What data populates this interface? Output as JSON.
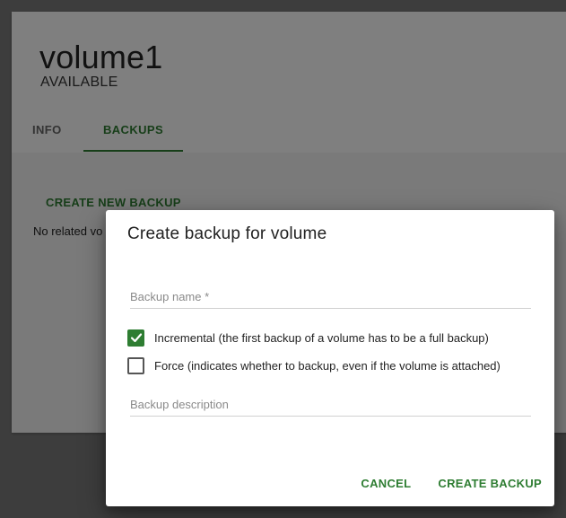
{
  "card": {
    "title": "volume1",
    "status": "AVAILABLE",
    "tabs": [
      {
        "label": "INFO"
      },
      {
        "label": "BACKUPS"
      }
    ],
    "create_new_label": "CREATE NEW BACKUP",
    "no_related_text": "No related vo"
  },
  "dialog": {
    "title": "Create backup for volume",
    "backup_name_placeholder": "Backup name *",
    "backup_description_placeholder": "Backup description",
    "incremental_label": "Incremental (the first backup of a volume has to be a full backup)",
    "incremental_checked": true,
    "force_label": "Force (indicates whether to backup, even if the volume is attached)",
    "force_checked": false,
    "cancel_label": "CANCEL",
    "create_label": "CREATE BACKUP"
  },
  "colors": {
    "accent": "#2e7d32",
    "overlay": "rgba(0,0,0,0.5)"
  }
}
